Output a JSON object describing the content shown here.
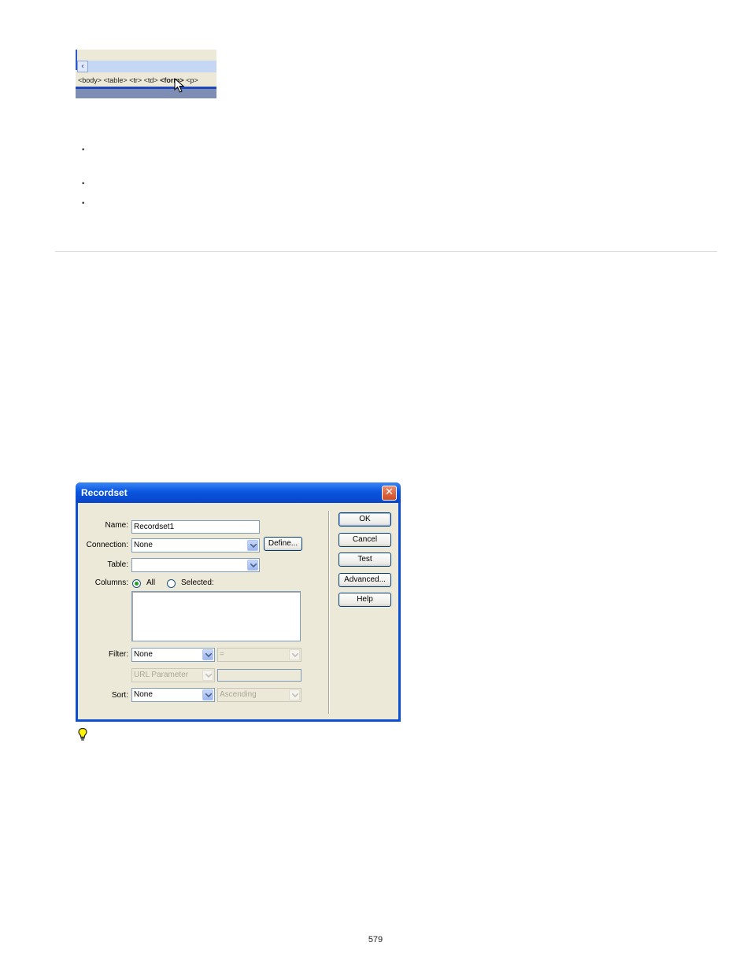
{
  "tag_selector": {
    "tags": [
      "<body>",
      "<table>",
      "<tr>",
      "<td>"
    ],
    "selected_tag": "<form>",
    "after_tag": "<p>",
    "scroll_left_glyph": "‹"
  },
  "bullets": [
    "•",
    "•",
    "•"
  ],
  "dialog": {
    "title": "Recordset",
    "close_glyph": "✕",
    "name_label": "Name:",
    "name_value": "Recordset1",
    "connection_label": "Connection:",
    "connection_value": "None",
    "define_button": "Define...",
    "table_label": "Table:",
    "table_value": "",
    "columns_label": "Columns:",
    "columns_all": "All",
    "columns_selected": "Selected:",
    "filter_label": "Filter:",
    "filter_value": "None",
    "filter_operator": "=",
    "filter_source": "URL Parameter",
    "filter_param": "",
    "sort_label": "Sort:",
    "sort_value": "None",
    "sort_order": "Ascending",
    "buttons": {
      "ok": "OK",
      "cancel": "Cancel",
      "test": "Test",
      "advanced": "Advanced...",
      "help": "Help"
    }
  },
  "page_number": "579"
}
